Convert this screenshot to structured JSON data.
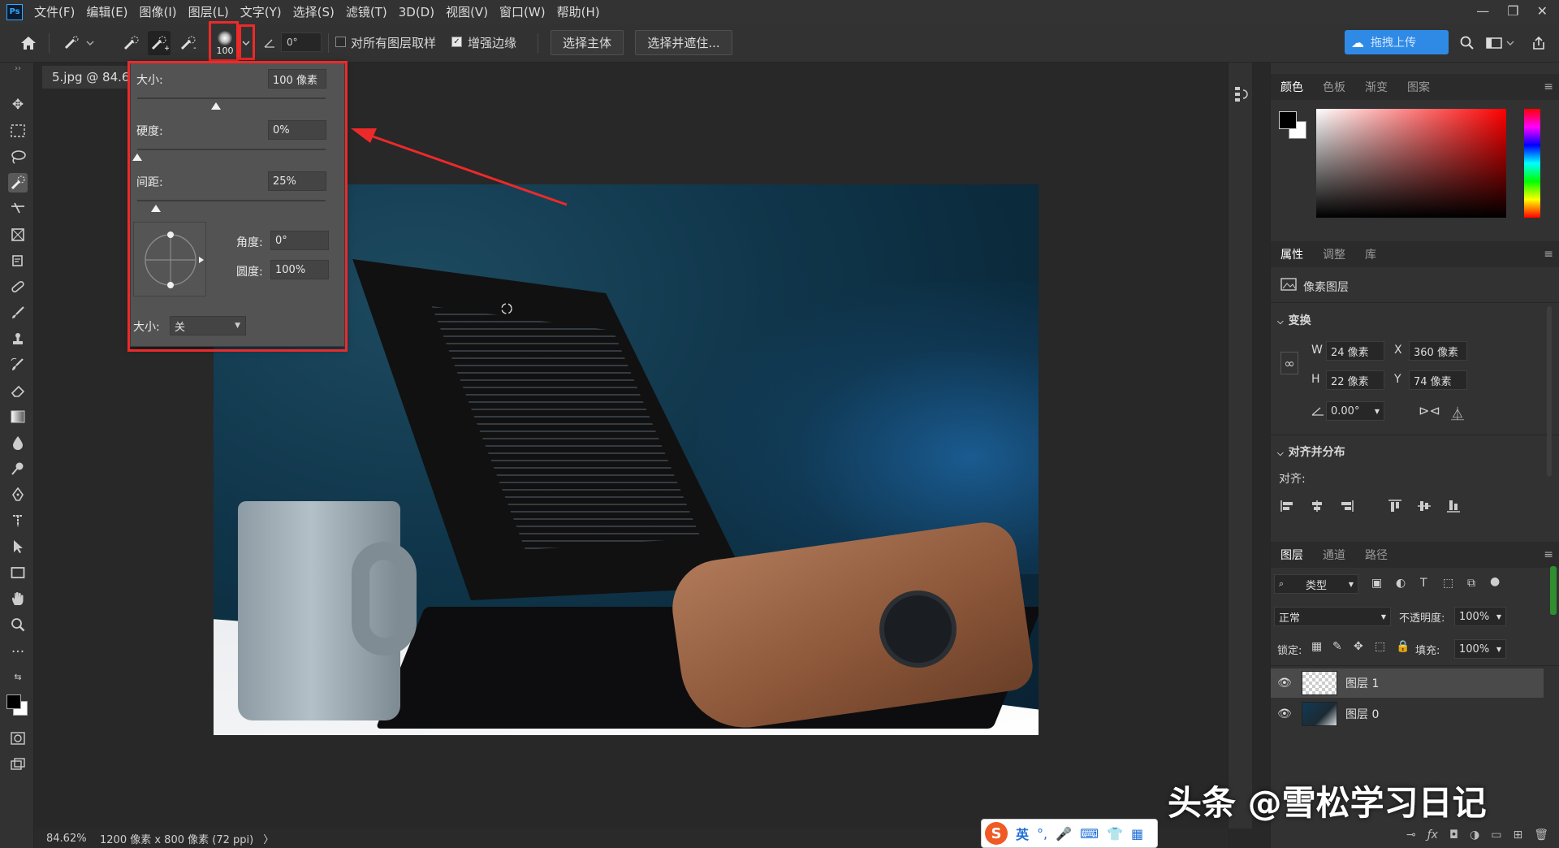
{
  "menu": [
    "文件(F)",
    "编辑(E)",
    "图像(I)",
    "图层(L)",
    "文字(Y)",
    "选择(S)",
    "滤镜(T)",
    "3D(D)",
    "视图(V)",
    "窗口(W)",
    "帮助(H)"
  ],
  "ps_logo": "Ps",
  "window_controls": {
    "minimize": "—",
    "restore": "❐",
    "close": "✕"
  },
  "options_bar": {
    "brush_size_value": "100",
    "angle_value": "0°",
    "sample_all_layers_label": "对所有图层取样",
    "enhance_edge_label": "增强边缘",
    "select_subject_label": "选择主体",
    "select_and_mask_label": "选择并遮住...",
    "upload_label": "拖拽上传"
  },
  "document": {
    "tab_title": "5.jpg @ 84.6"
  },
  "brush_popup": {
    "size_label": "大小:",
    "size_value": "100 像素",
    "size_fraction": 0.42,
    "hardness_label": "硬度:",
    "hardness_value": "0%",
    "hardness_fraction": 0.0,
    "spacing_label": "间距:",
    "spacing_value": "25%",
    "spacing_fraction": 0.1,
    "angle_label": "角度:",
    "angle_value": "0°",
    "roundness_label": "圆度:",
    "roundness_value": "100%",
    "size_control_label": "大小:",
    "size_control_value": "关"
  },
  "color_panel": {
    "tabs": [
      "颜色",
      "色板",
      "渐变",
      "图案"
    ],
    "foreground": "#000000",
    "background": "#ffffff"
  },
  "properties_panel": {
    "tabs": [
      "属性",
      "调整",
      "库"
    ],
    "layer_type": "像素图层",
    "transform_title": "变换",
    "w_label": "W",
    "w_value": "24 像素",
    "h_label": "H",
    "h_value": "22 像素",
    "x_label": "X",
    "x_value": "360 像素",
    "y_label": "Y",
    "y_value": "74 像素",
    "angle_value": "0.00°",
    "align_title": "对齐并分布",
    "align_label": "对齐:"
  },
  "layers_panel": {
    "tabs": [
      "图层",
      "通道",
      "路径"
    ],
    "filter_label": "类型",
    "blend_mode": "正常",
    "opacity_label": "不透明度:",
    "opacity_value": "100%",
    "lock_label": "锁定:",
    "fill_label": "填充:",
    "fill_value": "100%",
    "layers": [
      {
        "name": "图层 1",
        "selected": true
      },
      {
        "name": "图层 0",
        "selected": false
      }
    ]
  },
  "status_bar": {
    "zoom": "84.62%",
    "doc_info": "1200 像素 x 800 像素 (72 ppi)",
    "arrow": "〉"
  },
  "ime_bar": {
    "lang": "英"
  },
  "watermark": "头条 @雪松学习日记"
}
